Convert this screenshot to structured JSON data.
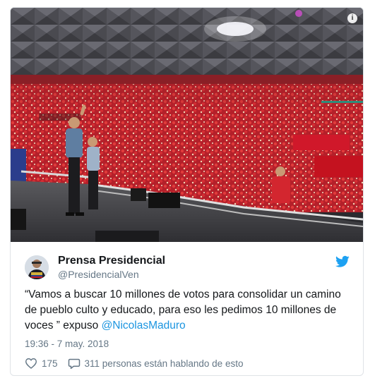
{
  "tweet": {
    "display_name": "Prensa Presidencial",
    "handle": "@PresidencialVen",
    "text_main": "“Vamos a buscar 10 millones de votos para consolidar un camino de pueblo culto y educado, para eso les pedimos 10 millones de voces ” expuso ",
    "mention": "@NicolasMaduro",
    "timestamp": "19:36 - 7 may. 2018",
    "likes": "175",
    "replies_text": "311 personas están hablando de esto"
  },
  "icons": {
    "info": "info-icon",
    "bird": "twitter-bird-icon",
    "heart": "heart-icon",
    "reply": "reply-bubble-icon"
  },
  "colors": {
    "link": "#1b95e0",
    "text": "#14171a",
    "muted": "#657786",
    "brand": "#1da1f2"
  }
}
